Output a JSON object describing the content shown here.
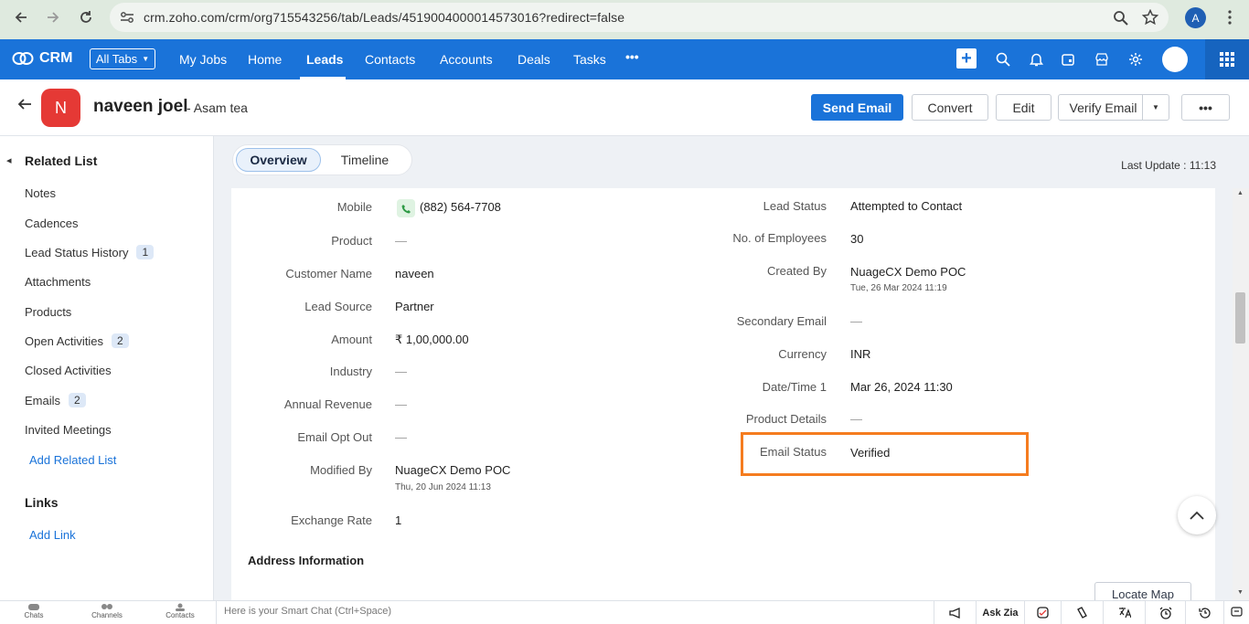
{
  "browser": {
    "url": "crm.zoho.com/crm/org715543256/tab/Leads/4519004000014573016?redirect=false",
    "profile_initial": "A"
  },
  "nav": {
    "logo": "CRM",
    "all_tabs": "All Tabs",
    "items": [
      "My Jobs",
      "Home",
      "Leads",
      "Contacts",
      "Accounts",
      "Deals",
      "Tasks"
    ],
    "more": "•••"
  },
  "record": {
    "avatar_initial": "N",
    "name": "naveen joel",
    "company": "- Asam tea",
    "buttons": {
      "send_email": "Send Email",
      "convert": "Convert",
      "edit": "Edit",
      "verify_email": "Verify Email",
      "more": "•••"
    }
  },
  "sidebar": {
    "related_title": "Related List",
    "items": [
      {
        "label": "Notes",
        "badge": ""
      },
      {
        "label": "Cadences",
        "badge": ""
      },
      {
        "label": "Lead Status History",
        "badge": "1"
      },
      {
        "label": "Attachments",
        "badge": ""
      },
      {
        "label": "Products",
        "badge": ""
      },
      {
        "label": "Open Activities",
        "badge": "2"
      },
      {
        "label": "Closed Activities",
        "badge": ""
      },
      {
        "label": "Emails",
        "badge": "2"
      },
      {
        "label": "Invited Meetings",
        "badge": ""
      }
    ],
    "add_related": "Add Related List",
    "links_title": "Links",
    "add_link": "Add Link"
  },
  "main": {
    "tabs": [
      "Overview",
      "Timeline"
    ],
    "last_update": "Last Update : 11:13"
  },
  "fields_left": [
    {
      "label": "Mobile",
      "value": "(882) 564-7708"
    },
    {
      "label": "Product",
      "value": "—"
    },
    {
      "label": "Customer Name",
      "value": "naveen"
    },
    {
      "label": "Lead Source",
      "value": "Partner"
    },
    {
      "label": "Amount",
      "value": "₹ 1,00,000.00"
    },
    {
      "label": "Industry",
      "value": "—"
    },
    {
      "label": "Annual Revenue",
      "value": "—"
    },
    {
      "label": "Email Opt Out",
      "value": "—"
    },
    {
      "label": "Modified By",
      "value": "NuageCX Demo POC",
      "sub": "Thu, 20 Jun 2024 11:13"
    },
    {
      "label": "Exchange Rate",
      "value": "1"
    }
  ],
  "fields_right": [
    {
      "label": "Lead Status",
      "value": "Attempted to Contact"
    },
    {
      "label": "No. of Employees",
      "value": "30"
    },
    {
      "label": "Created By",
      "value": "NuageCX Demo POC",
      "sub": "Tue, 26 Mar 2024 11:19"
    },
    {
      "label": "Secondary Email",
      "value": "—"
    },
    {
      "label": "Currency",
      "value": "INR"
    },
    {
      "label": "Date/Time 1",
      "value": "Mar 26, 2024 11:30"
    },
    {
      "label": "Product Details",
      "value": "—"
    },
    {
      "label": "Email Status",
      "value": "Verified"
    }
  ],
  "address_title": "Address Information",
  "locate_map": "Locate Map",
  "bottom": {
    "chats": "Chats",
    "channels": "Channels",
    "contacts": "Contacts",
    "smart_chat": "Here is your Smart Chat (Ctrl+Space)",
    "ask_zia": "Ask Zia"
  },
  "colors": {
    "accent": "#1a73d9",
    "highlight": "#f57c1f",
    "avatar": "#e53935"
  }
}
